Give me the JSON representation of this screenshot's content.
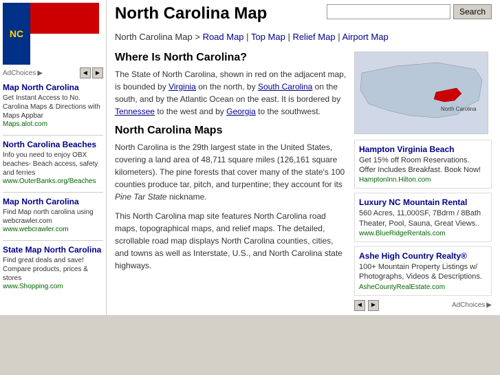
{
  "page": {
    "title": "North Carolina Map",
    "search": {
      "placeholder": "",
      "button_label": "Search"
    },
    "nav": {
      "breadcrumb_text": "North Carolina Map",
      "separator": " > ",
      "links": [
        {
          "label": "Road Map",
          "href": "#"
        },
        {
          "label": "Top Map",
          "href": "#"
        },
        {
          "label": "Relief Map",
          "href": "#"
        },
        {
          "label": "Airport Map",
          "href": "#"
        }
      ]
    },
    "section1_title": "Where Is North Carolina?",
    "section1_text1": "The State of North Carolina, shown in red on the adjacent map, is bounded by ",
    "section1_virginia": "Virginia",
    "section1_text2": " on the north, by ",
    "section1_south_carolina": "South Carolina",
    "section1_text3": " on the south, and by the Atlantic Ocean on the east.  It is bordered by ",
    "section1_tennessee": "Tennessee",
    "section1_text4": " to the west and by ",
    "section1_georgia": "Georgia",
    "section1_text5": " to the southwest.",
    "section2_title": "North Carolina Maps",
    "section2_text": "North Carolina is the 29th largest state in the United States, covering a land area of 48,711 square miles (126,161 square kilometers). The pine forests that cover many of the state's 100 counties produce tar, pitch, and turpentine; they account for its ",
    "section2_nickname": "Pine Tar State",
    "section2_text2": " nickname.",
    "section3_text": "This North Carolina map site features North Carolina road maps, topographical maps, and relief maps.  The detailed, scrollable road map displays North Carolina counties, cities, and towns as well as Interstate, U.S., and North Carolina state highways."
  },
  "sidebar": {
    "ad_choices_label": "AdChoices",
    "sections": [
      {
        "title": "Map North Carolina",
        "text": "Get Instant Access to No. Carolina Maps & Directions with Maps Appbar",
        "url": "Maps.alot.com"
      },
      {
        "title": "North Carolina Beaches",
        "text": "Info you need to enjoy OBX beaches- Beach access, safety and ferries",
        "url": "www.OuterBanks.org/Beaches"
      },
      {
        "title": "Map North Carolina",
        "text": "Find Map north carolina using webcrawler.com",
        "url": "www.webcrawler.com"
      },
      {
        "title": "State Map North Carolina",
        "text": "Find great deals and save! Compare products, prices & stores",
        "url": "www.Shopping.com"
      }
    ]
  },
  "ads": [
    {
      "title": "Hampton Virginia Beach",
      "text": "Get 15% off Room Reservations. Offer Includes Breakfast. Book Now!",
      "url": "HamptonInn.Hilton.com"
    },
    {
      "title": "Luxury NC Mountain Rental",
      "text": "560 Acres, 11,000SF, 7Bdrm / 8Bath Theater, Pool, Sauna, Great Views..",
      "url": "www.BlueRidgeRentals.com"
    },
    {
      "title": "Ashe High Country Realty®",
      "text": "100+ Mountain Property Listings w/ Photographs, Videos & Descriptions.",
      "url": "AsheCountyRealEstate.com"
    }
  ],
  "icons": {
    "left_arrow": "◄",
    "right_arrow": "►",
    "triangle_right": "▶"
  }
}
